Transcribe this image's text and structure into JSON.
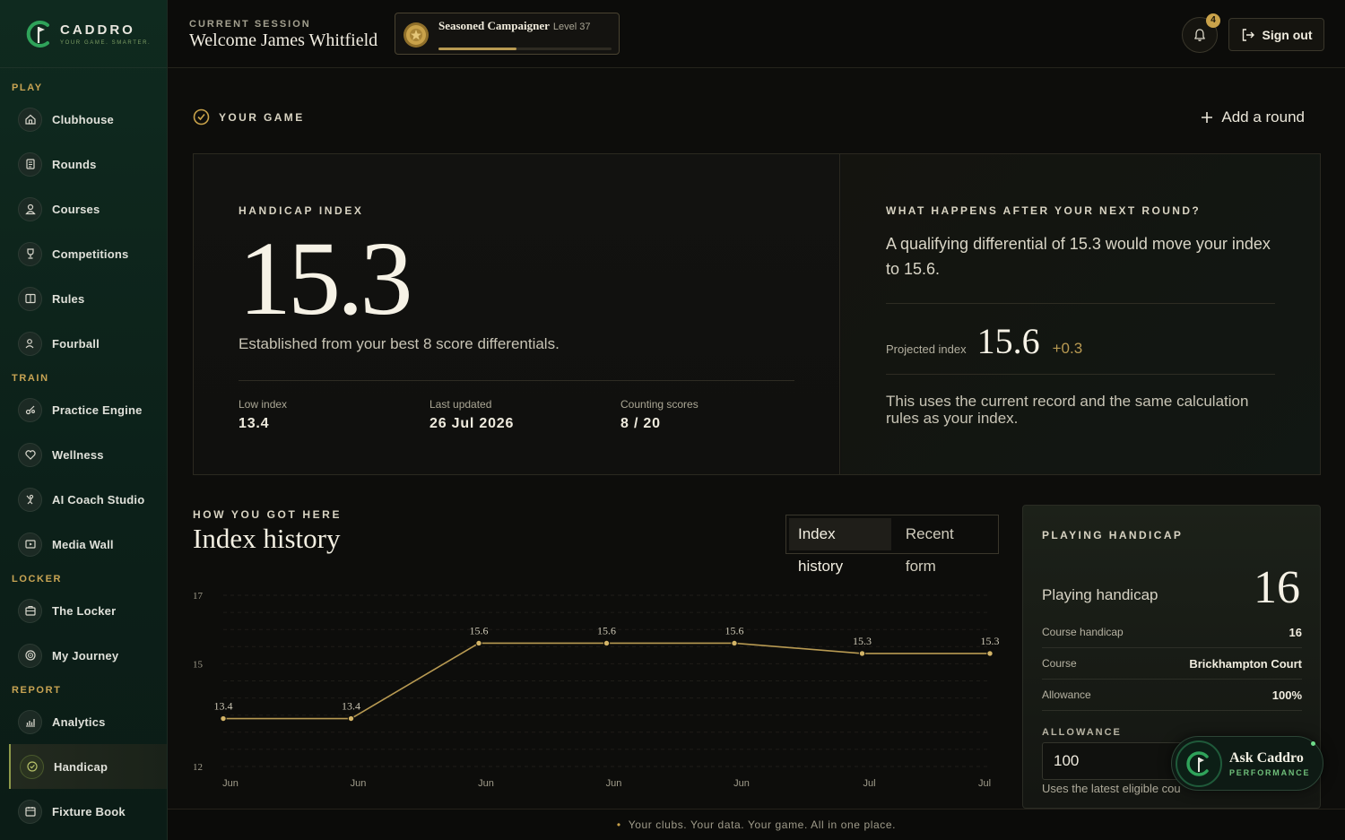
{
  "brand": {
    "name": "CADDRO",
    "tagline": "YOUR GAME. SMARTER."
  },
  "sidebar": {
    "sections": [
      {
        "label": "PLAY",
        "items": [
          "Clubhouse",
          "Rounds",
          "Courses",
          "Competitions",
          "Rules",
          "Fourball"
        ]
      },
      {
        "label": "TRAIN",
        "items": [
          "Practice Engine",
          "Wellness",
          "AI Coach Studio",
          "Media Wall"
        ]
      },
      {
        "label": "LOCKER",
        "items": [
          "The Locker",
          "My Journey"
        ]
      },
      {
        "label": "REPORT",
        "items": [
          "Analytics",
          "Handicap",
          "Fixture Book"
        ]
      }
    ],
    "active": "Handicap"
  },
  "header": {
    "session_label": "CURRENT SESSION",
    "welcome": "Welcome James Whitfield",
    "badge_title": "Seasoned Campaigner",
    "badge_level": "Level 37",
    "badge_progress": 0.45,
    "notification_count": "4",
    "signout_label": "Sign out"
  },
  "main": {
    "section_label": "YOUR GAME",
    "add_round_label": "Add a round",
    "index": {
      "label": "HANDICAP INDEX",
      "value": "15.3",
      "description": "Established from your best 8 score differentials.",
      "stats": [
        {
          "label": "Low index",
          "value": "13.4"
        },
        {
          "label": "Last updated",
          "value": "26 Jul 2026"
        },
        {
          "label": "Counting scores",
          "value": "8 / 20"
        }
      ]
    },
    "next_round": {
      "label": "WHAT HAPPENS AFTER YOUR NEXT ROUND?",
      "text": "A qualifying differential of 15.3 would move your index to 15.6.",
      "projected_label": "Projected index",
      "projected_value": "15.6",
      "projected_delta": "+0.3",
      "note": "This uses the current record and the same calculation rules as your index."
    },
    "history": {
      "section_label": "HOW YOU GOT HERE",
      "title": "Index history",
      "tabs": [
        "Index history",
        "Recent form"
      ],
      "active_tab": "Index history"
    },
    "playing_handicap": {
      "label": "PLAYING HANDICAP",
      "sub_label": "Playing handicap",
      "value": "16",
      "rows": [
        {
          "label": "Course handicap",
          "value": "16"
        },
        {
          "label": "Course",
          "value": "Brickhampton Court"
        },
        {
          "label": "Allowance",
          "value": "100%"
        }
      ],
      "allowance_label": "ALLOWANCE",
      "allowance_value": "100",
      "allowance_note": "Uses the latest eligible cou"
    }
  },
  "ask": {
    "title": "Ask Caddro",
    "subtitle": "PERFORMANCE"
  },
  "footer": {
    "text": "Your clubs. Your data. Your game. All in one place."
  },
  "colors": {
    "accent_gold": "#c9a24a",
    "line_gold": "#b89a52",
    "brand_green": "#1f5a3a"
  },
  "chart_data": {
    "type": "line",
    "categories": [
      "Jun",
      "Jun",
      "Jun",
      "Jun",
      "Jun",
      "Jul",
      "Jul"
    ],
    "series": [
      {
        "values": [
          13.4,
          13.4,
          15.6,
          15.6,
          15.6,
          15.3,
          15.3
        ]
      }
    ],
    "data_labels": [
      "13.4",
      "13.4",
      "15.6",
      "15.6",
      "15.6",
      "15.3",
      "15.3"
    ],
    "y_ticks": [
      12,
      15,
      17
    ],
    "ylim": [
      12,
      17
    ],
    "grid": true
  }
}
